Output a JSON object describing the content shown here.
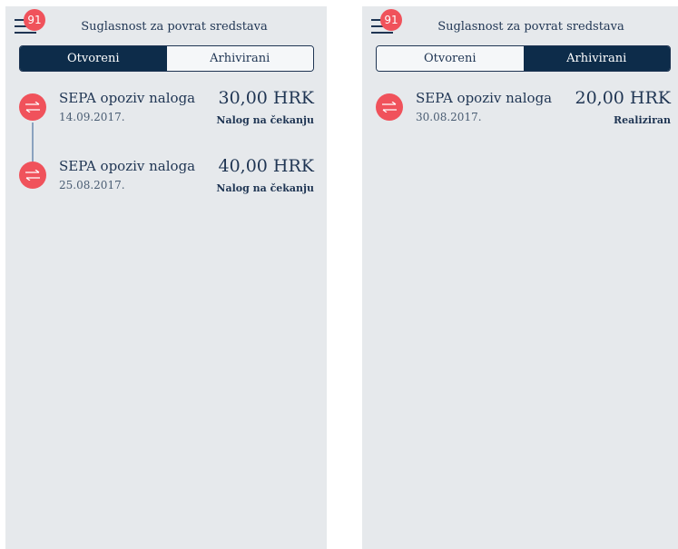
{
  "screens": [
    {
      "header": {
        "badge_count": "91",
        "title": "Suglasnost za povrat sredstava"
      },
      "tabs": [
        {
          "label": "Otvoreni",
          "active": true
        },
        {
          "label": "Arhivirani",
          "active": false
        }
      ],
      "items": [
        {
          "name": "SEPA opoziv naloga",
          "date": "14.09.2017.",
          "amount": "30,00 HRK",
          "status": "Nalog na čekanju",
          "icon": "transfer-icon"
        },
        {
          "name": "SEPA opoziv naloga",
          "date": "25.08.2017.",
          "amount": "40,00 HRK",
          "status": "Nalog na čekanju",
          "icon": "transfer-icon"
        }
      ]
    },
    {
      "header": {
        "badge_count": "91",
        "title": "Suglasnost za povrat sredstava"
      },
      "tabs": [
        {
          "label": "Otvoreni",
          "active": false
        },
        {
          "label": "Arhivirani",
          "active": true
        }
      ],
      "items": [
        {
          "name": "SEPA opoziv naloga",
          "date": "30.08.2017.",
          "amount": "20,00 HRK",
          "status": "Realiziran",
          "icon": "transfer-icon"
        }
      ]
    }
  ],
  "colors": {
    "accent_red": "#f0525b",
    "navy": "#0d2c4a",
    "text": "#1f3553",
    "background": "#e6e9ec",
    "connector": "#8aa2bf"
  }
}
